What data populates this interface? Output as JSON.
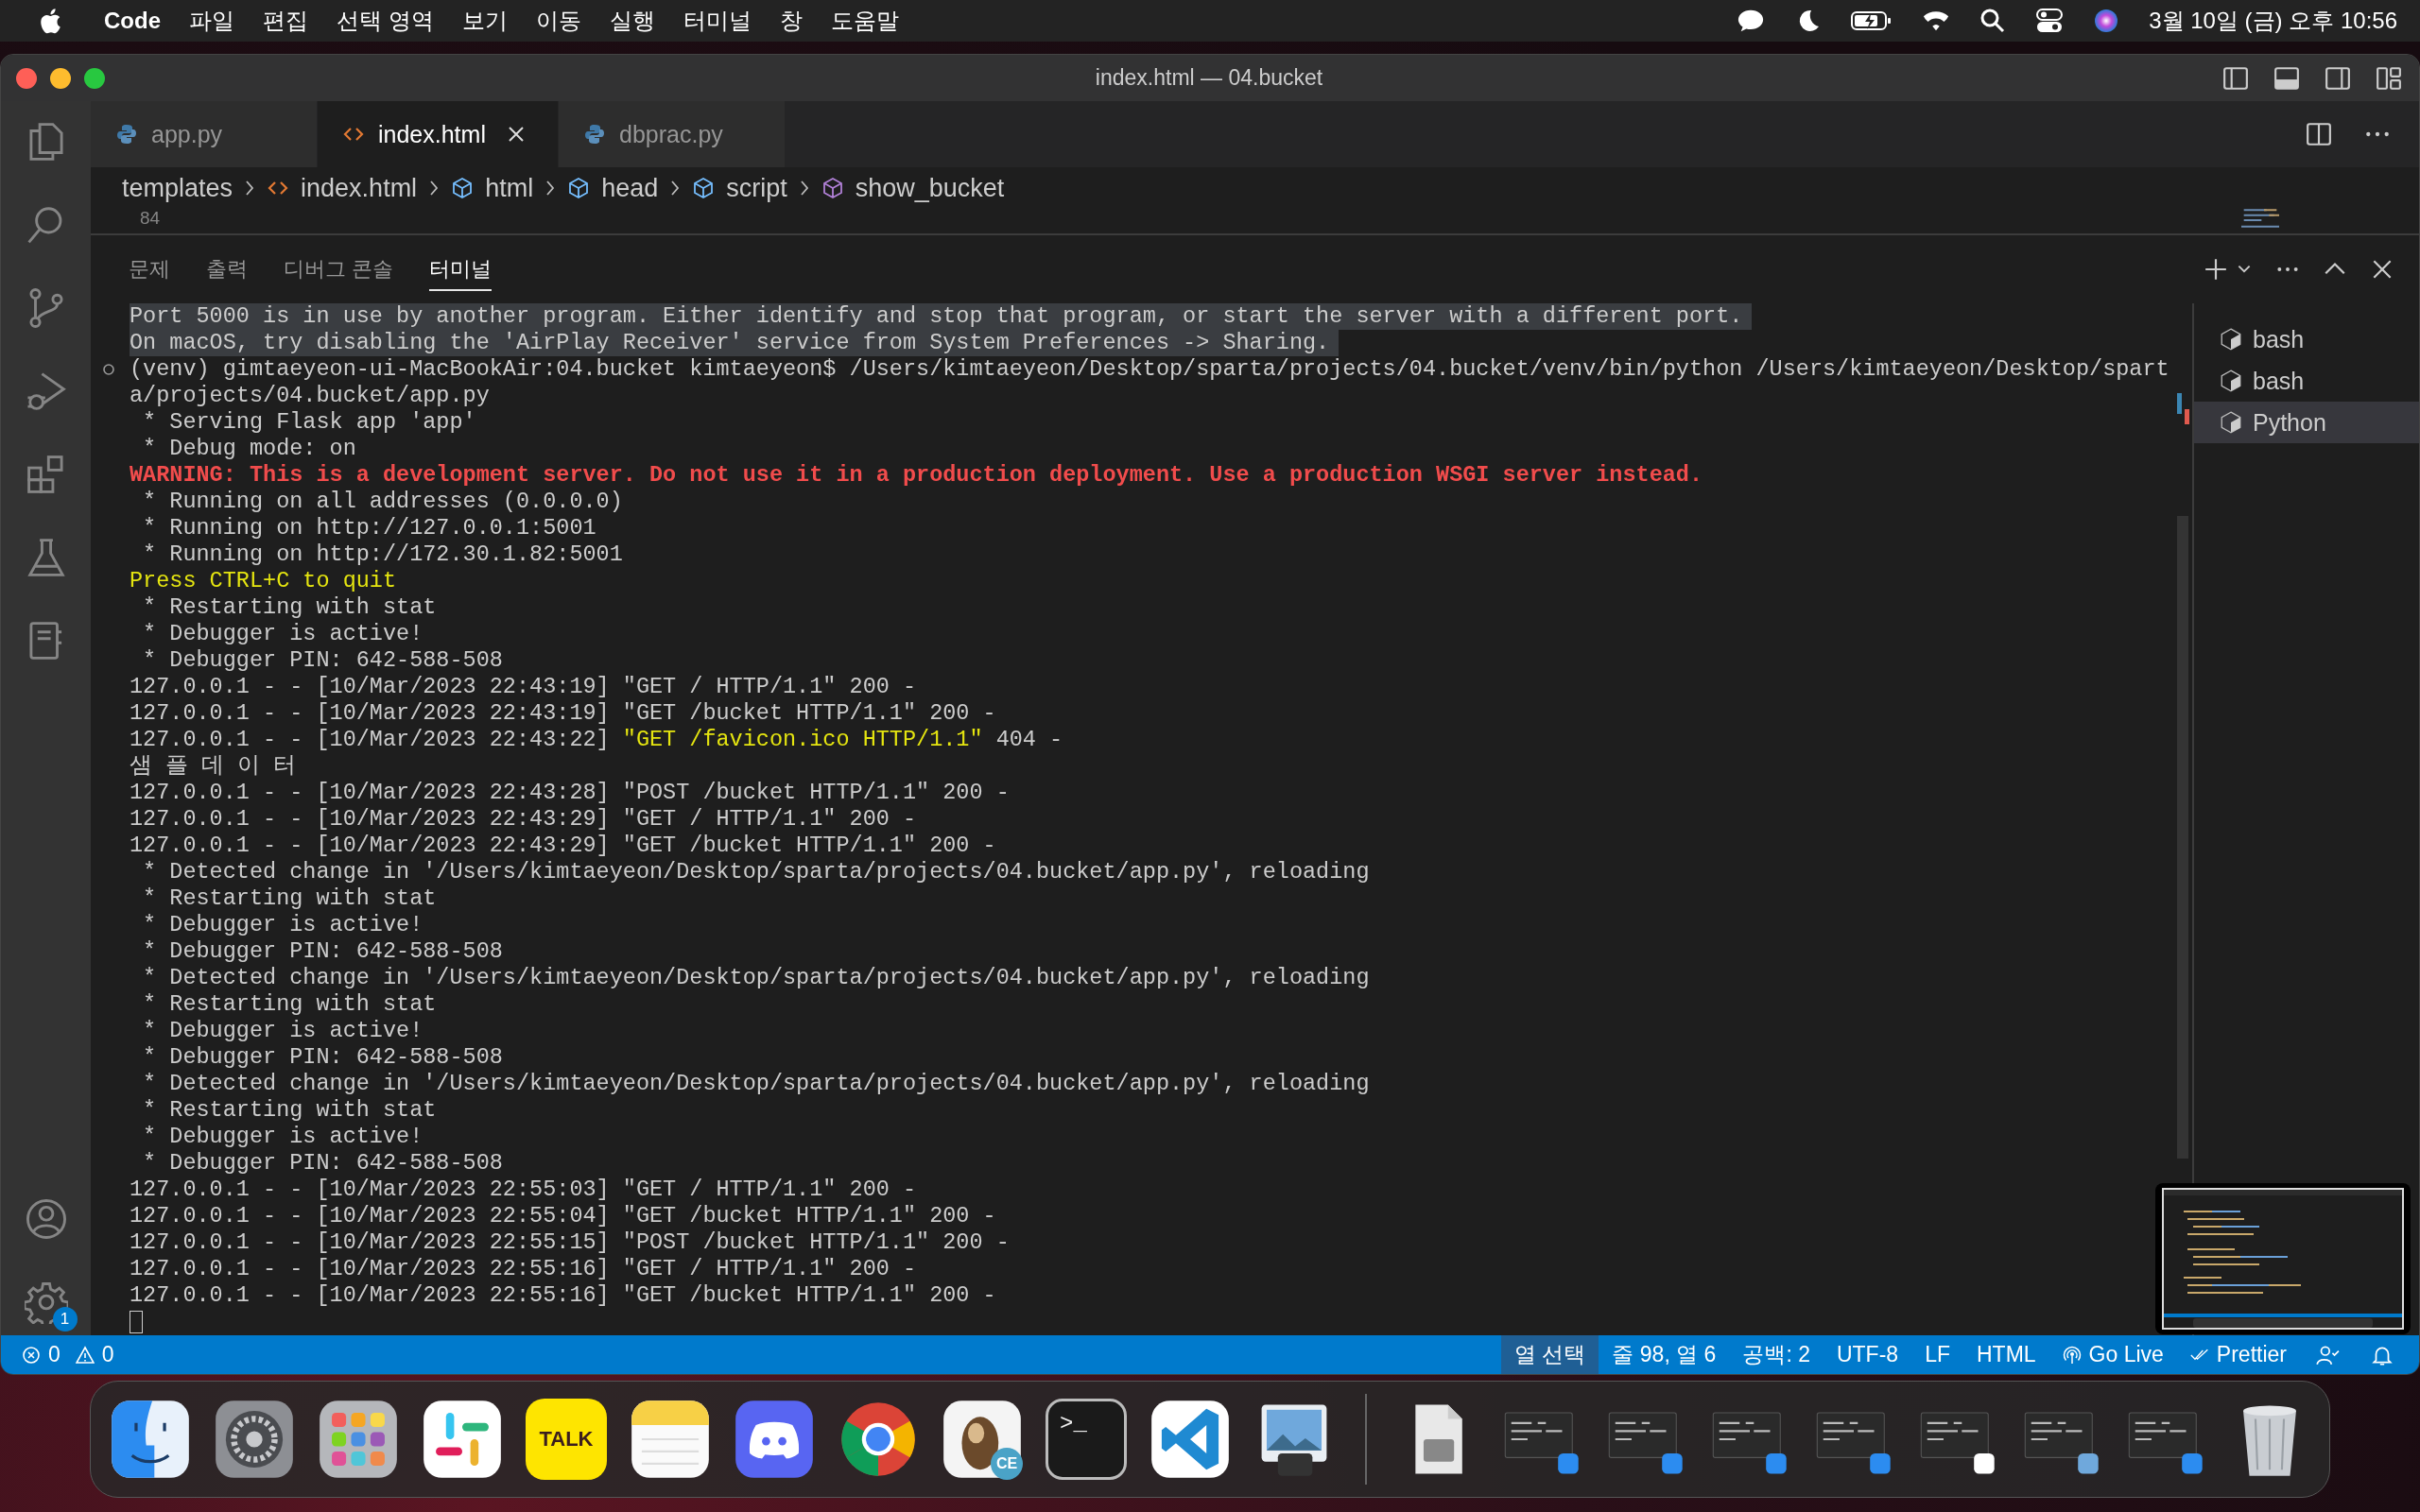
{
  "menu_bar": {
    "app": "Code",
    "menus": [
      "파일",
      "편집",
      "선택 영역",
      "보기",
      "이동",
      "실행",
      "터미널",
      "창",
      "도움말"
    ],
    "clock": "3월 10일 (금) 오후 10:56"
  },
  "window": {
    "title": "index.html — 04.bucket"
  },
  "editor_tabs": [
    {
      "label": "app.py",
      "kind": "python",
      "selected": false
    },
    {
      "label": "index.html",
      "kind": "html",
      "selected": true
    },
    {
      "label": "dbprac.py",
      "kind": "python",
      "selected": false
    }
  ],
  "breadcrumb": [
    {
      "label": "templates",
      "kind": "folder"
    },
    {
      "label": "index.html",
      "kind": "html"
    },
    {
      "label": "html",
      "kind": "element"
    },
    {
      "label": "head",
      "kind": "element"
    },
    {
      "label": "script",
      "kind": "element"
    },
    {
      "label": "show_bucket",
      "kind": "function"
    }
  ],
  "editor": {
    "line_number": "84"
  },
  "panel_tabs": [
    {
      "label": "문제",
      "selected": false
    },
    {
      "label": "출력",
      "selected": false
    },
    {
      "label": "디버그 콘솔",
      "selected": false
    },
    {
      "label": "터미널",
      "selected": true
    }
  ],
  "terminal": {
    "lines": [
      {
        "kind": "selected",
        "text": "Port 5000 is in use by another program. Either identify and stop that program, or start the server with a different port."
      },
      {
        "kind": "selected",
        "text": "On macOS, try disabling the 'AirPlay Receiver' service from System Preferences -> Sharing."
      },
      {
        "kind": "prompt",
        "text": "(venv) gimtaeyeon-ui-MacBookAir:04.bucket kimtaeyeon$ /Users/kimtaeyeon/Desktop/sparta/projects/04.bucket/venv/bin/python /Users/kimtaeyeon/Desktop/spart"
      },
      {
        "kind": "plain",
        "text": "a/projects/04.bucket/app.py"
      },
      {
        "kind": "plain",
        "text": " * Serving Flask app 'app'"
      },
      {
        "kind": "plain",
        "text": " * Debug mode: on"
      },
      {
        "kind": "warning",
        "text": "WARNING: This is a development server. Do not use it in a production deployment. Use a production WSGI server instead."
      },
      {
        "kind": "plain",
        "text": " * Running on all addresses (0.0.0.0)"
      },
      {
        "kind": "plain",
        "text": " * Running on http://127.0.0.1:5001"
      },
      {
        "kind": "plain",
        "text": " * Running on http://172.30.1.82:5001"
      },
      {
        "kind": "notice",
        "text": "Press CTRL+C to quit"
      },
      {
        "kind": "plain",
        "text": " * Restarting with stat"
      },
      {
        "kind": "plain",
        "text": " * Debugger is active!"
      },
      {
        "kind": "plain",
        "text": " * Debugger PIN: 642-588-508"
      },
      {
        "kind": "plain",
        "text": "127.0.0.1 - - [10/Mar/2023 22:43:19] \"GET / HTTP/1.1\" 200 -"
      },
      {
        "kind": "plain",
        "text": "127.0.0.1 - - [10/Mar/2023 22:43:19] \"GET /bucket HTTP/1.1\" 200 -"
      },
      {
        "kind": "mixed",
        "segments": [
          {
            "kind": "plain",
            "text": "127.0.0.1 - - [10/Mar/2023 22:43:22] "
          },
          {
            "kind": "notice",
            "text": "\"GET /favicon.ico HTTP/1.1\""
          },
          {
            "kind": "plain",
            "text": " 404 -"
          }
        ]
      },
      {
        "kind": "plain",
        "text": "샘 플 데 이 터"
      },
      {
        "kind": "plain",
        "text": "127.0.0.1 - - [10/Mar/2023 22:43:28] \"POST /bucket HTTP/1.1\" 200 -"
      },
      {
        "kind": "plain",
        "text": "127.0.0.1 - - [10/Mar/2023 22:43:29] \"GET / HTTP/1.1\" 200 -"
      },
      {
        "kind": "plain",
        "text": "127.0.0.1 - - [10/Mar/2023 22:43:29] \"GET /bucket HTTP/1.1\" 200 -"
      },
      {
        "kind": "plain",
        "text": " * Detected change in '/Users/kimtaeyeon/Desktop/sparta/projects/04.bucket/app.py', reloading"
      },
      {
        "kind": "plain",
        "text": " * Restarting with stat"
      },
      {
        "kind": "plain",
        "text": " * Debugger is active!"
      },
      {
        "kind": "plain",
        "text": " * Debugger PIN: 642-588-508"
      },
      {
        "kind": "plain",
        "text": " * Detected change in '/Users/kimtaeyeon/Desktop/sparta/projects/04.bucket/app.py', reloading"
      },
      {
        "kind": "plain",
        "text": " * Restarting with stat"
      },
      {
        "kind": "plain",
        "text": " * Debugger is active!"
      },
      {
        "kind": "plain",
        "text": " * Debugger PIN: 642-588-508"
      },
      {
        "kind": "plain",
        "text": " * Detected change in '/Users/kimtaeyeon/Desktop/sparta/projects/04.bucket/app.py', reloading"
      },
      {
        "kind": "plain",
        "text": " * Restarting with stat"
      },
      {
        "kind": "plain",
        "text": " * Debugger is active!"
      },
      {
        "kind": "plain",
        "text": " * Debugger PIN: 642-588-508"
      },
      {
        "kind": "plain",
        "text": "127.0.0.1 - - [10/Mar/2023 22:55:03] \"GET / HTTP/1.1\" 200 -"
      },
      {
        "kind": "plain",
        "text": "127.0.0.1 - - [10/Mar/2023 22:55:04] \"GET /bucket HTTP/1.1\" 200 -"
      },
      {
        "kind": "plain",
        "text": "127.0.0.1 - - [10/Mar/2023 22:55:15] \"POST /bucket HTTP/1.1\" 200 -"
      },
      {
        "kind": "plain",
        "text": "127.0.0.1 - - [10/Mar/2023 22:55:16] \"GET / HTTP/1.1\" 200 -"
      },
      {
        "kind": "plain",
        "text": "127.0.0.1 - - [10/Mar/2023 22:55:16] \"GET /bucket HTTP/1.1\" 200 -"
      },
      {
        "kind": "cursor"
      }
    ]
  },
  "terminals": [
    {
      "label": "bash",
      "selected": false
    },
    {
      "label": "bash",
      "selected": false
    },
    {
      "label": "Python",
      "selected": true
    }
  ],
  "activity_bar": {
    "settings_badge": "1"
  },
  "status_bar": {
    "errors": "0",
    "warnings": "0",
    "items": [
      {
        "kind": "text",
        "label": "열 선택",
        "highlighted": true
      },
      {
        "kind": "text",
        "label": "줄 98, 열 6",
        "highlighted": false
      },
      {
        "kind": "text",
        "label": "공백: 2",
        "highlighted": false
      },
      {
        "kind": "text",
        "label": "UTF-8",
        "highlighted": false
      },
      {
        "kind": "text",
        "label": "LF",
        "highlighted": false
      },
      {
        "kind": "text",
        "label": "HTML",
        "highlighted": false
      },
      {
        "kind": "broadcast",
        "label": "Go Live",
        "highlighted": false
      },
      {
        "kind": "check",
        "label": "Prettier",
        "highlighted": false
      }
    ]
  },
  "dock": [
    {
      "kind": "finder"
    },
    {
      "kind": "settings"
    },
    {
      "kind": "launchpad"
    },
    {
      "kind": "pinwheel"
    },
    {
      "kind": "talk",
      "label": "TALK"
    },
    {
      "kind": "notes"
    },
    {
      "kind": "gamepad"
    },
    {
      "kind": "browser"
    },
    {
      "kind": "animal",
      "label": "CE"
    },
    {
      "kind": "terminal",
      "label": ">_"
    },
    {
      "kind": "ribbon"
    },
    {
      "kind": "viewer"
    },
    {
      "kind": "divider"
    },
    {
      "kind": "document"
    },
    {
      "kind": "window",
      "badge": {
        "kind": "finder"
      }
    },
    {
      "kind": "window",
      "badge": {
        "kind": "finder"
      }
    },
    {
      "kind": "window",
      "badge": {
        "kind": "finder"
      }
    },
    {
      "kind": "window",
      "badge": {
        "kind": "finder"
      }
    },
    {
      "kind": "window",
      "badge": {
        "kind": "pinwheel"
      }
    },
    {
      "kind": "window",
      "badge": {
        "kind": "viewer"
      }
    },
    {
      "kind": "window",
      "badge": {
        "kind": "finder"
      }
    },
    {
      "kind": "trash"
    }
  ]
}
